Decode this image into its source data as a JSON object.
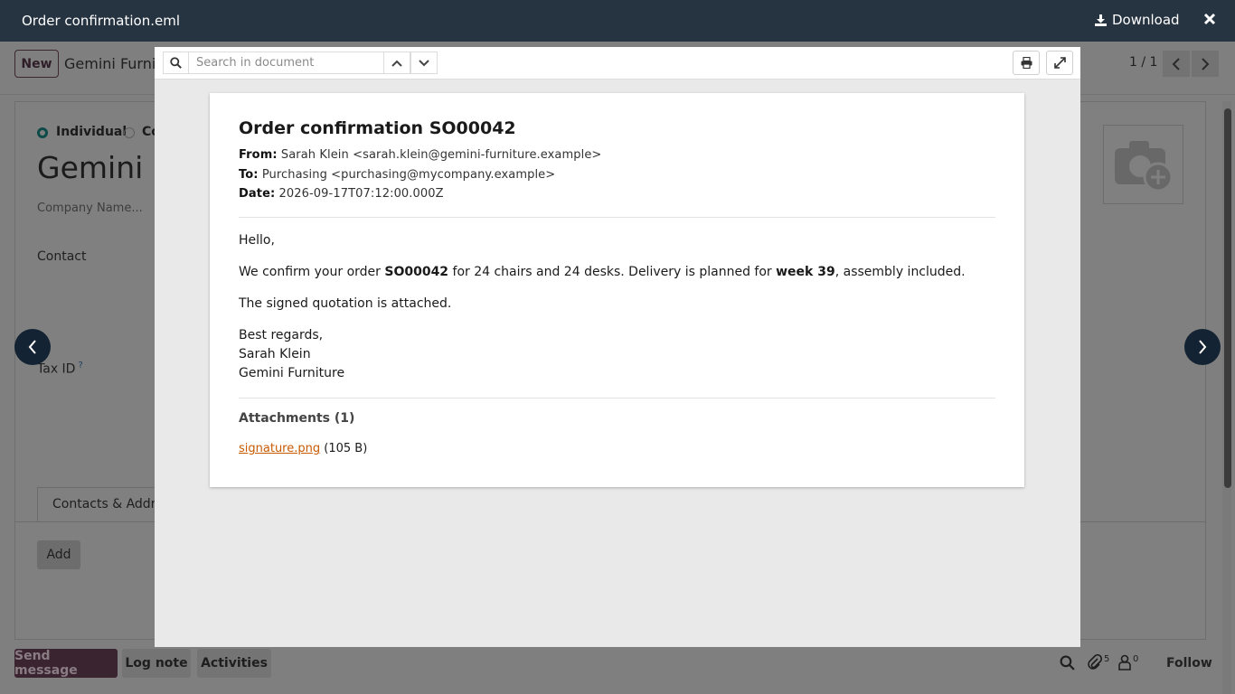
{
  "window": {
    "title": "Order confirmation.eml",
    "download_label": "Download"
  },
  "background": {
    "new_label": "New",
    "breadcrumb": "Gemini Furnit",
    "pager": "1 / 1",
    "radio_individual": "Individual",
    "radio_company": "Co",
    "record_name": "Gemini F",
    "company_placeholder": "Company Name...",
    "contact_label": "Contact",
    "tax_id_label": "Tax ID",
    "tax_id_help": "?",
    "tab_label": "Contacts & Addres",
    "add_label": "Add",
    "send_message": "Send message",
    "log_note": "Log note",
    "activities": "Activities",
    "attachments_count": "5",
    "followers_count": "0",
    "follow": "Follow"
  },
  "viewer": {
    "search_placeholder": "Search in document",
    "email": {
      "subject": "Order confirmation SO00042",
      "from_label": "From:",
      "from": "Sarah Klein <sarah.klein@gemini-furniture.example>",
      "to_label": "To:",
      "to": "Purchasing <purchasing@mycompany.example>",
      "date_label": "Date:",
      "date": "2026-09-17T07:12:00.000Z",
      "greeting": "Hello,",
      "p1_a": "We confirm your order ",
      "p1_order": "SO00042",
      "p1_b": " for 24 chairs and 24 desks. Delivery is planned for ",
      "p1_week": "week 39",
      "p1_c": ", assembly included.",
      "p2": "The signed quotation is attached.",
      "closing": "Best regards,",
      "sig_name": "Sarah Klein",
      "sig_company": "Gemini Furniture",
      "attachments_title": "Attachments (1)",
      "attachment_name": "signature.png",
      "attachment_size": "(105 B)"
    }
  },
  "colors": {
    "topbar": "#263341",
    "nav_circle": "#142333",
    "link": "#c85a00",
    "accent": "#3a2430"
  }
}
